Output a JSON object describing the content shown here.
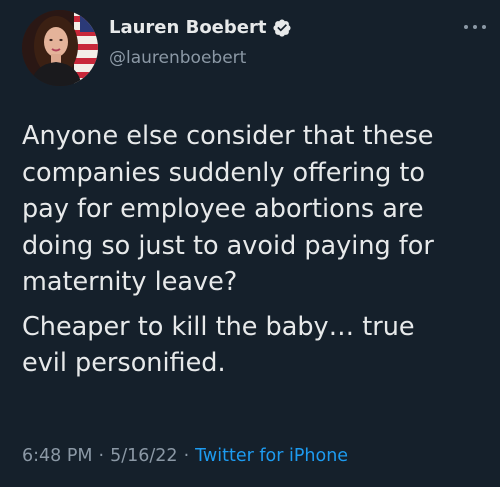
{
  "author": {
    "display_name": "Lauren Boebert",
    "handle": "@laurenboebert",
    "verified": true,
    "avatar_icon": "profile-photo"
  },
  "tweet": {
    "paragraphs": [
      "Anyone else consider that these\ncompanies suddenly offering to\npay for employee abortions are\ndoing so just to avoid paying for\nmaternity leave?",
      "Cheaper to kill the baby… true\nevil personified."
    ]
  },
  "meta": {
    "time": "6:48 PM",
    "date": "5/16/22",
    "source": "Twitter for iPhone",
    "separator": "·"
  },
  "colors": {
    "background": "#15202b",
    "primary_text": "#e7e9ea",
    "secondary_text": "#8b98a5",
    "link": "#1d9bf0",
    "verified": "#1d9bf0"
  },
  "icons": {
    "more": "more-horizontal-icon",
    "verified": "verified-badge-icon"
  }
}
